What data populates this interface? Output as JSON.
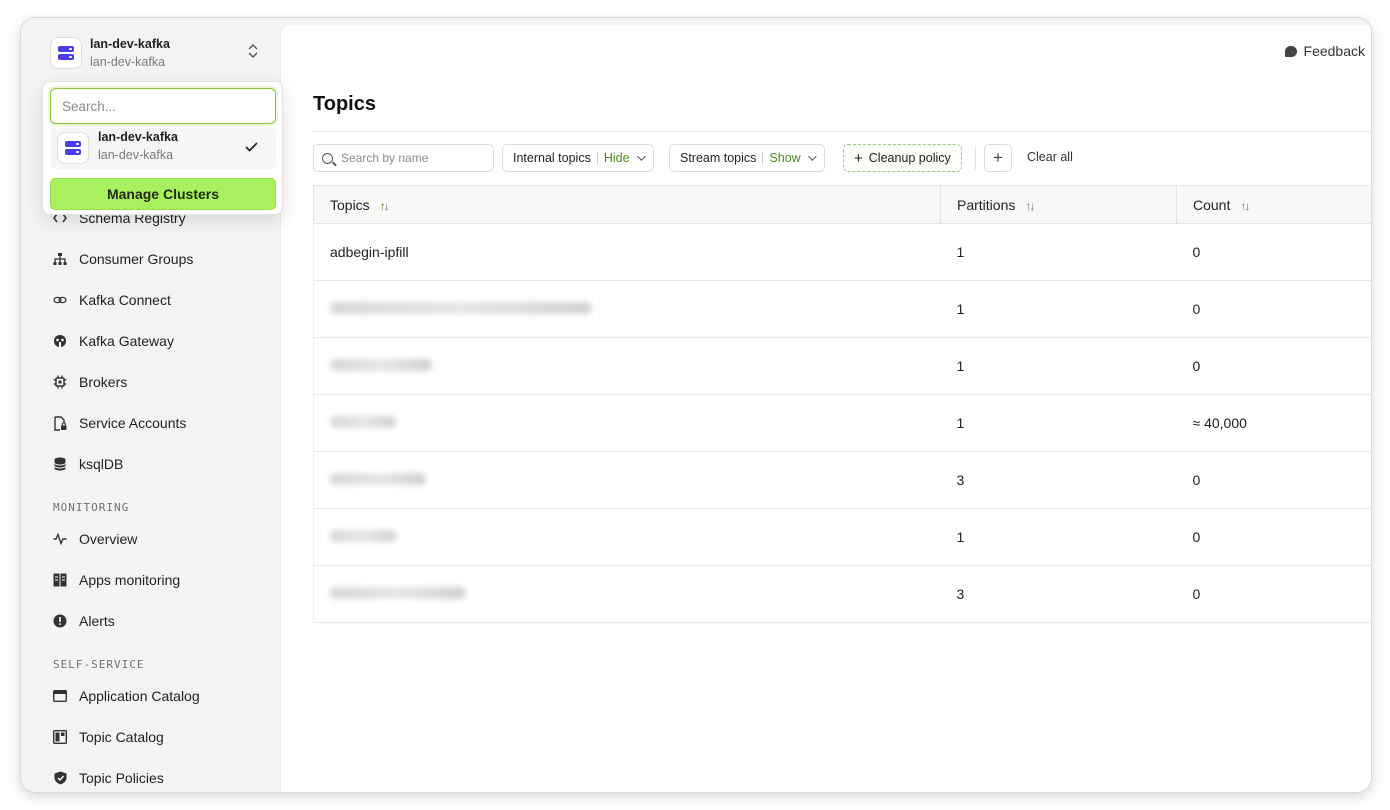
{
  "cluster": {
    "name": "lan-dev-kafka",
    "subtitle": "lan-dev-kafka"
  },
  "dropdown": {
    "search_placeholder": "Search...",
    "items": [
      {
        "name": "lan-dev-kafka",
        "subtitle": "lan-dev-kafka",
        "selected": true
      }
    ],
    "manage_label": "Manage Clusters"
  },
  "nav": {
    "items": [
      {
        "label": "Schema Registry",
        "icon": "code-brackets-icon"
      },
      {
        "label": "Consumer Groups",
        "icon": "hierarchy-icon"
      },
      {
        "label": "Kafka Connect",
        "icon": "link-icon"
      },
      {
        "label": "Kafka Gateway",
        "icon": "gateway-icon"
      },
      {
        "label": "Brokers",
        "icon": "chip-icon"
      },
      {
        "label": "Service Accounts",
        "icon": "file-lock-icon"
      },
      {
        "label": "ksqlDB",
        "icon": "database-icon"
      }
    ],
    "monitoring_label": "MONITORING",
    "monitoring_items": [
      {
        "label": "Overview",
        "icon": "pulse-icon"
      },
      {
        "label": "Apps monitoring",
        "icon": "columns-icon"
      },
      {
        "label": "Alerts",
        "icon": "alert-circle-icon"
      }
    ],
    "self_service_label": "SELF-SERVICE",
    "self_service_items": [
      {
        "label": "Application Catalog",
        "icon": "window-icon"
      },
      {
        "label": "Topic Catalog",
        "icon": "layout-icon"
      },
      {
        "label": "Topic Policies",
        "icon": "shield-icon"
      }
    ]
  },
  "header": {
    "feedback_label": "Feedback",
    "title": "Topics"
  },
  "filters": {
    "search_placeholder": "Search by name",
    "internal_topics_label": "Internal topics",
    "internal_topics_value": "Hide",
    "stream_topics_label": "Stream topics",
    "stream_topics_value": "Show",
    "cleanup_policy_label": "Cleanup policy",
    "add_label": "+",
    "clear_all_label": "Clear all"
  },
  "table": {
    "columns": [
      "Topics",
      "Partitions",
      "Count"
    ],
    "rows": [
      {
        "topic": "adbegin-ipfill",
        "partitions": "1",
        "count": "0",
        "blurred": false
      },
      {
        "topic": "",
        "partitions": "1",
        "count": "0",
        "blurred": true
      },
      {
        "topic": "",
        "partitions": "1",
        "count": "0",
        "blurred": true
      },
      {
        "topic": "",
        "partitions": "1",
        "count": "≈ 40,000",
        "blurred": true
      },
      {
        "topic": "",
        "partitions": "3",
        "count": "0",
        "blurred": true
      },
      {
        "topic": "",
        "partitions": "1",
        "count": "0",
        "blurred": true
      },
      {
        "topic": "",
        "partitions": "3",
        "count": "0",
        "blurred": true
      }
    ]
  },
  "colors": {
    "accent_green": "#a9f05f",
    "cluster_icon": "#4b3ee8",
    "filter_value": "#4c8a1f"
  }
}
